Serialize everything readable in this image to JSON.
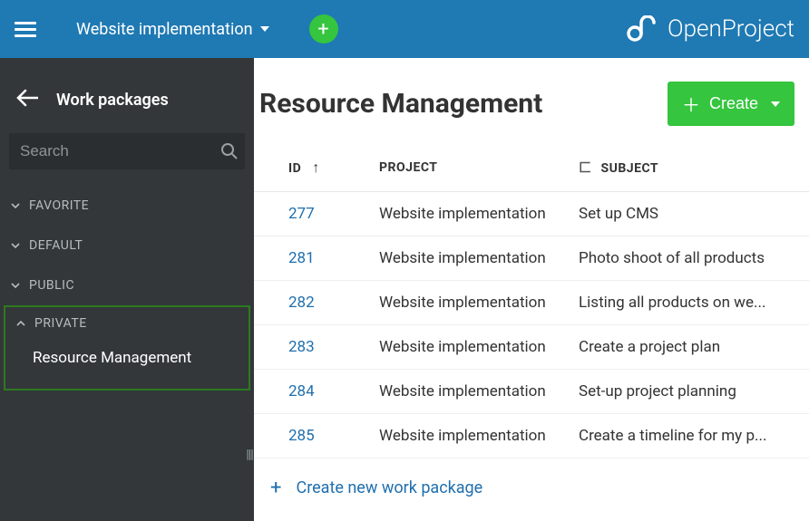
{
  "topbar": {
    "project_name": "Website implementation",
    "brand_name": "OpenProject"
  },
  "sidebar": {
    "title": "Work packages",
    "search_placeholder": "Search",
    "sections": {
      "favorite": "FAVORITE",
      "default": "DEFAULT",
      "public": "PUBLIC",
      "private": "PRIVATE"
    },
    "private_items": [
      {
        "label": "Resource Management"
      }
    ]
  },
  "main": {
    "title": "Resource Management",
    "create_label": "Create",
    "columns": {
      "id": "ID",
      "project": "PROJECT",
      "subject": "SUBJECT"
    },
    "rows": [
      {
        "id": "277",
        "project": "Website implementation",
        "subject": "Set up CMS"
      },
      {
        "id": "281",
        "project": "Website implementation",
        "subject": "Photo shoot of all products"
      },
      {
        "id": "282",
        "project": "Website implementation",
        "subject": "Listing all products on we..."
      },
      {
        "id": "283",
        "project": "Website implementation",
        "subject": "Create a project plan"
      },
      {
        "id": "284",
        "project": "Website implementation",
        "subject": "Set-up project planning"
      },
      {
        "id": "285",
        "project": "Website implementation",
        "subject": "Create a timeline for my p..."
      }
    ],
    "create_new_label": "Create new work package"
  }
}
